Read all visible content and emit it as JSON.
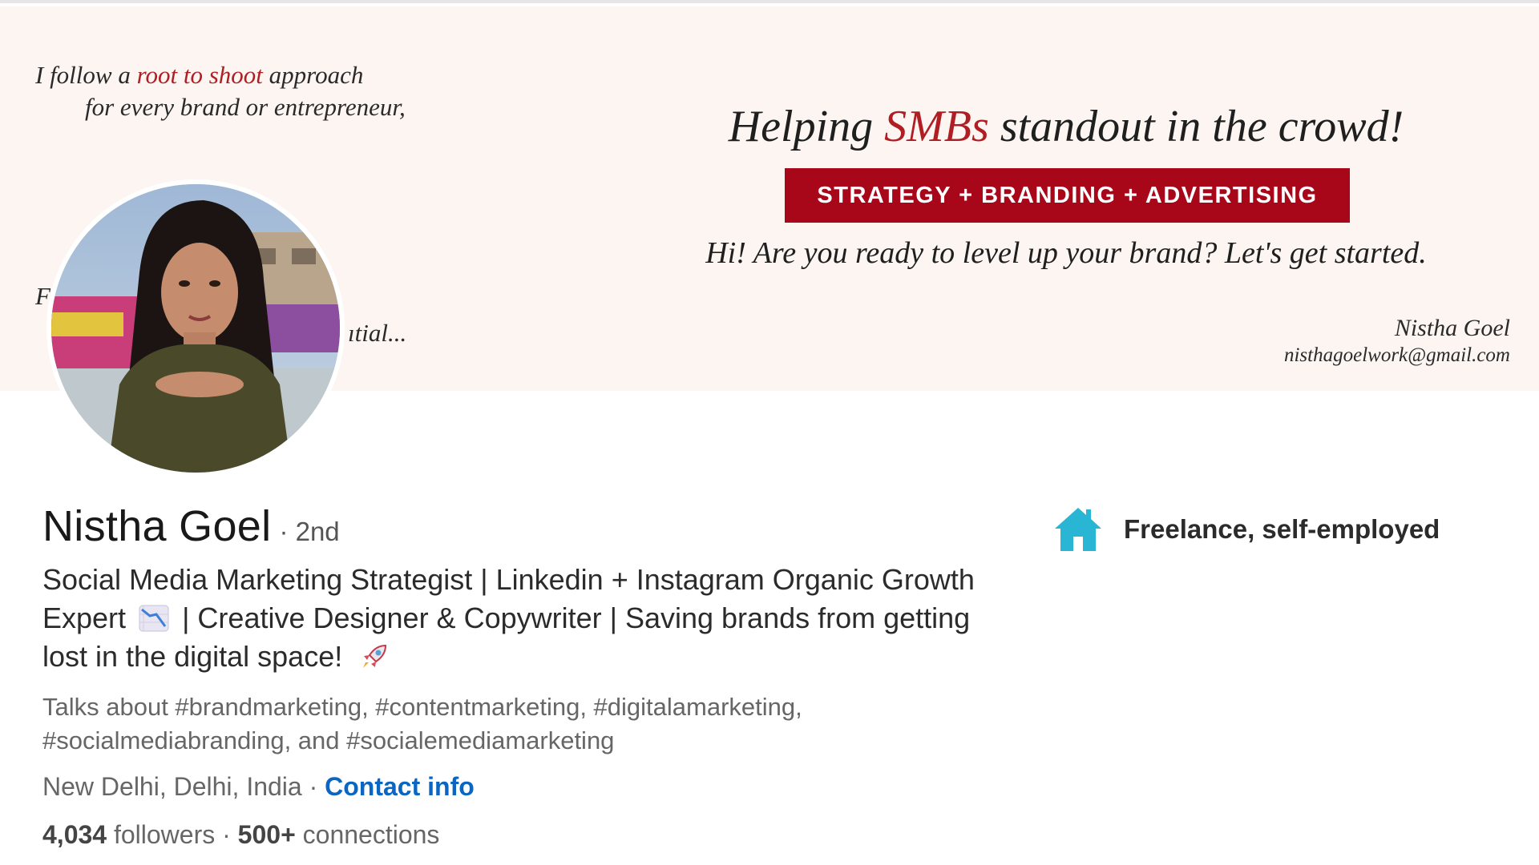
{
  "banner": {
    "intro_prefix": "I follow a ",
    "intro_accent": "root to shoot",
    "intro_suffix": " approach",
    "intro_line2": "for every brand or entrepreneur,",
    "fragment_left": "F",
    "fragment_right": "ıtial...",
    "headline_prefix": "Helping ",
    "headline_accent": "SMBs",
    "headline_suffix": " standout in the crowd!",
    "pill": "STRATEGY + BRANDING + ADVERTISING",
    "subline": "Hi! Are you ready to level up your brand? Let's get started.",
    "sign_name": "Nistha Goel",
    "sign_email": "nisthagoelwork@gmail.com"
  },
  "profile": {
    "name": "Nistha Goel",
    "degree": "· 2nd",
    "headline_part1": "Social Media Marketing Strategist | Linkedin + Instagram Organic Growth Expert",
    "headline_part2": "| Creative Designer & Copywriter | Saving brands from getting lost in the digital space!",
    "talks_about": "Talks about #brandmarketing, #contentmarketing, #digitalamarketing, #socialmediabranding, and #socialemediamarketing",
    "location": "New Delhi, Delhi, India",
    "location_sep": " · ",
    "contact_label": "Contact info",
    "followers_count": "4,034",
    "followers_label": " followers",
    "connections_sep": "  · ",
    "connections_count": "500+",
    "connections_label": " connections"
  },
  "current_position": {
    "label": "Freelance, self-employed",
    "icon": "house-icon"
  },
  "colors": {
    "accent_red": "#a8071a",
    "link_blue": "#0a66c2",
    "banner_bg": "#fcf5f1",
    "house_blue": "#28b6d4"
  }
}
